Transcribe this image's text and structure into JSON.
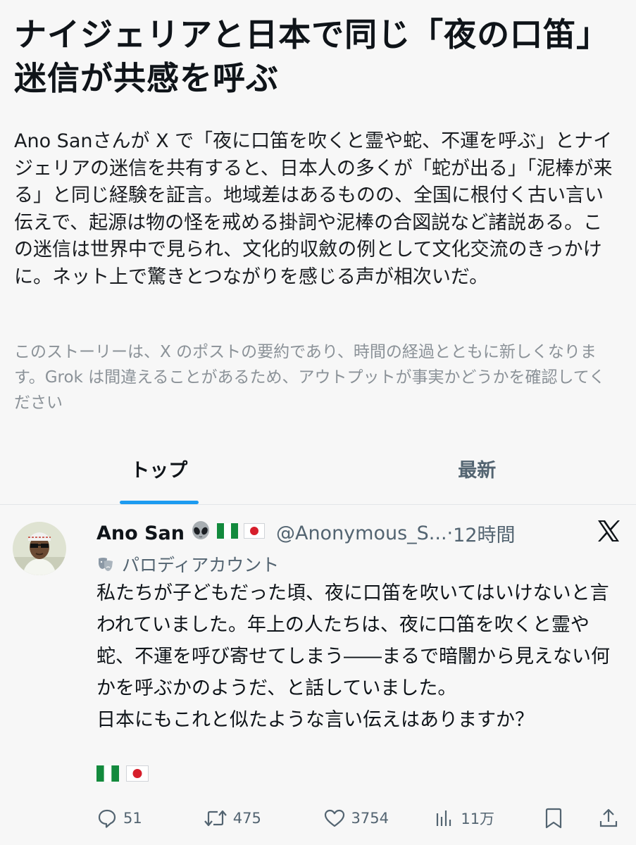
{
  "story": {
    "headline": "ナイジェリアと日本で同じ「夜の口笛」迷信が共感を呼ぶ",
    "summary": "Ano Sanさんが X で「夜に口笛を吹くと霊や蛇、不運を呼ぶ」とナイジェリアの迷信を共有すると、日本人の多くが「蛇が出る」「泥棒が来る」と同じ経験を証言。地域差はあるものの、全国に根付く古い言い伝えで、起源は物の怪を戒める掛詞や泥棒の合図説など諸説ある。この迷信は世界中で見られ、文化的収斂の例として文化交流のきっかけに。ネット上で驚きとつながりを感じる声が相次いだ。",
    "disclaimer": "このストーリーは、X のポストの要約であり、時間の経過とともに新しくなります。Grok は間違えることがあるため、アウトプットが事実かどうかを確認してください"
  },
  "tabs": [
    {
      "label": "トップ",
      "active": true
    },
    {
      "label": "最新",
      "active": false
    }
  ],
  "post": {
    "author": "Ano San",
    "author_emojis": [
      "alien-emoji",
      "nigeria-flag",
      "japan-flag"
    ],
    "handle": "@Anonymous_S...",
    "separator": "·",
    "time": "12時間",
    "account_type": "パロディアカウント",
    "body": "私たちが子どもだった頃、夜に口笛を吹いてはいけないと言われていました。年上の人たちは、夜に口笛を吹くと霊や蛇、不運を呼び寄せてしまう――まるで暗闇から見えない何かを呼ぶかのようだ、と話していました。\n日本にもこれと似たような言い伝えはありますか？",
    "body_flags": [
      "nigeria-flag",
      "japan-flag"
    ],
    "replies": "51",
    "reposts": "475",
    "likes": "3754",
    "views": "11万"
  },
  "colors": {
    "background": "#f7f7f7",
    "text": "#0f1419",
    "secondary": "#536471",
    "accent": "#1d9bf0"
  }
}
